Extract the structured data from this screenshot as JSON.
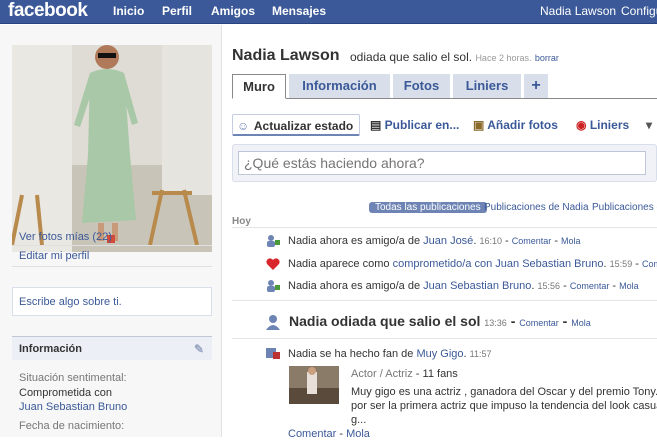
{
  "topbar": {
    "logo": "facebook",
    "nav": [
      "Inicio",
      "Perfil",
      "Amigos",
      "Mensajes"
    ],
    "user": "Nadia Lawson",
    "settings": "Configu"
  },
  "sidebar": {
    "view_photos": "Ver fotos mías (22)",
    "edit_profile": "Editar mi perfil",
    "write_about": "Escribe algo sobre ti.",
    "info_title": "Información",
    "relationship_label": "Situación sentimental:",
    "relationship_value": "Comprometida con",
    "relationship_partner": "Juan Sebastian Bruno",
    "birthday_label": "Fecha de nacimiento:"
  },
  "profile": {
    "name": "Nadia Lawson",
    "status": "odiada que salio el sol.",
    "status_time": "Hace 2 horas.",
    "status_delete": "borrar"
  },
  "tabs": [
    "Muro",
    "Información",
    "Fotos",
    "Liniers",
    "+"
  ],
  "actions": {
    "update_status": "Actualizar estado",
    "publish": "Publicar en...",
    "add_photos": "Añadir fotos",
    "liniers": "Liniers"
  },
  "composer": {
    "placeholder": "¿Qué estás haciendo ahora?"
  },
  "filters": [
    "Todas las publicaciones",
    "Publicaciones de Nadia",
    "Publicaciones de"
  ],
  "feed": {
    "day": "Hoy",
    "s1": {
      "text": "Nadia ahora es amigo/a de",
      "link": "Juan José",
      "time": "16:10",
      "comment": "Comentar",
      "like": "Mola"
    },
    "s2": {
      "text": "Nadia aparece como",
      "link": "comprometido/a con Juan Sebastian Bruno",
      "time": "15:59",
      "comment": "Come"
    },
    "s3": {
      "text": "Nadia ahora es amigo/a de",
      "link": "Juan Sebastian Bruno",
      "time": "15:56",
      "comment": "Comentar",
      "like": "Mola"
    },
    "s4": {
      "text": "Nadia odiada que salio el sol",
      "time": "13:36",
      "comment": "Comentar",
      "like": "Mola"
    },
    "s5": {
      "text": "Nadia se ha hecho fan de",
      "link": "Muy Gigo",
      "time": "11:57",
      "category": "Actor / Actriz",
      "fans": "11 fans",
      "desc1": "Muy gigo es una actriz , ganadora del Oscar y del premio Tony.",
      "desc2": "por ser la primera actriz que impuso la tendencia del look casual",
      "desc3": "g...",
      "comment": "Comentar",
      "like": "Mola"
    }
  }
}
